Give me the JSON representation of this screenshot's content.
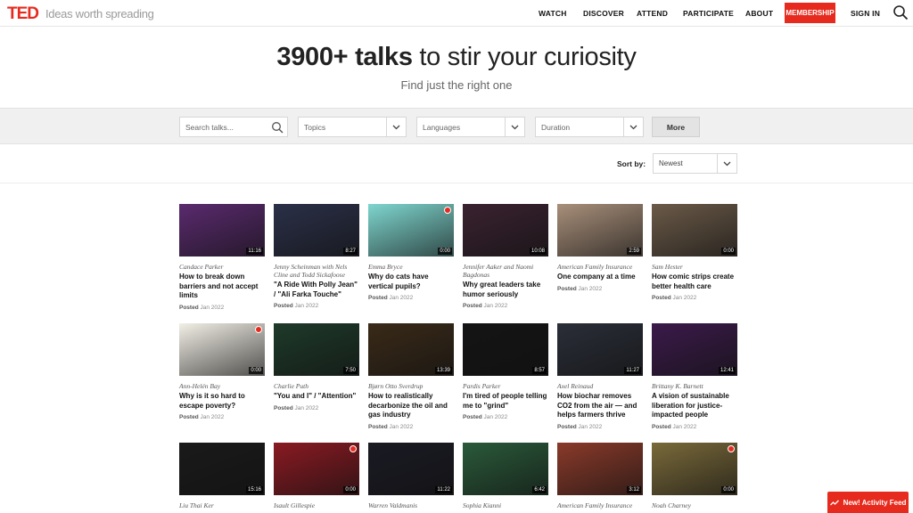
{
  "nav": {
    "logo": "TED",
    "tagline": "Ideas worth spreading",
    "links": [
      "WATCH",
      "DISCOVER",
      "ATTEND",
      "PARTICIPATE",
      "ABOUT"
    ],
    "membership": "MEMBERSHIP",
    "signin": "SIGN IN"
  },
  "hero": {
    "title_bold": "3900+ talks",
    "title_rest": " to stir your curiosity",
    "subtitle": "Find just the right one"
  },
  "filters": {
    "search_placeholder": "Search talks...",
    "topics": "Topics",
    "languages": "Languages",
    "duration": "Duration",
    "more": "More",
    "sort_label": "Sort by:",
    "sort_value": "Newest"
  },
  "talks": [
    {
      "speaker": "Candace Parker",
      "title": "How to break down barriers and not accept limits",
      "posted": "Jan 2022",
      "duration": "11:16",
      "badge": false,
      "bg": "#5a2a6e"
    },
    {
      "speaker": "Jenny Scheinman with Nels Cline and Todd Sickafoose",
      "title": "\"A Ride With Polly Jean\" / \"Ali Farka Touche\"",
      "posted": "Jan 2022",
      "duration": "8:27",
      "badge": false,
      "bg": "#2b3048"
    },
    {
      "speaker": "Emma Bryce",
      "title": "Why do cats have vertical pupils?",
      "posted": "Jan 2022",
      "duration": "0:00",
      "badge": true,
      "bg": "#7fd6cf"
    },
    {
      "speaker": "Jennifer Aaker and Naomi Bagdonas",
      "title": "Why great leaders take humor seriously",
      "posted": "Jan 2022",
      "duration": "10:08",
      "badge": false,
      "bg": "#3a2230"
    },
    {
      "speaker": "American Family Insurance",
      "title": "One company at a time",
      "posted": "Jan 2022",
      "duration": "2:59",
      "badge": false,
      "bg": "#a88f7a"
    },
    {
      "speaker": "Sam Hester",
      "title": "How comic strips create better health care",
      "posted": "Jan 2022",
      "duration": "0:00",
      "badge": false,
      "bg": "#6b5a48"
    },
    {
      "speaker": "Ann-Helén Bay",
      "title": "Why is it so hard to escape poverty?",
      "posted": "Jan 2022",
      "duration": "0:00",
      "badge": true,
      "bg": "#f2efe6"
    },
    {
      "speaker": "Charlie Puth",
      "title": "\"You and I\" / \"Attention\"",
      "posted": "Jan 2022",
      "duration": "7:50",
      "badge": false,
      "bg": "#1e3a2a"
    },
    {
      "speaker": "Bjørn Otto Sverdrup",
      "title": "How to realistically decarbonize the oil and gas industry",
      "posted": "Jan 2022",
      "duration": "13:39",
      "badge": false,
      "bg": "#3a2a18"
    },
    {
      "speaker": "Pardis Parker",
      "title": "I'm tired of people telling me to \"grind\"",
      "posted": "Jan 2022",
      "duration": "8:57",
      "badge": false,
      "bg": "#141414"
    },
    {
      "speaker": "Axel Reinaud",
      "title": "How biochar removes CO2 from the air — and helps farmers thrive",
      "posted": "Jan 2022",
      "duration": "11:27",
      "badge": false,
      "bg": "#2a2e38"
    },
    {
      "speaker": "Brittany K. Barnett",
      "title": "A vision of sustainable liberation for justice-impacted people",
      "posted": "Jan 2022",
      "duration": "12:41",
      "badge": false,
      "bg": "#3b1a4a"
    },
    {
      "speaker": "Liu Thai Ker",
      "title": "",
      "posted": "",
      "duration": "15:16",
      "badge": false,
      "bg": "#1a1a1a"
    },
    {
      "speaker": "Isault Gillespie",
      "title": "",
      "posted": "",
      "duration": "0:00",
      "badge": true,
      "bg": "#8a1a22"
    },
    {
      "speaker": "Warren Valdmanis",
      "title": "",
      "posted": "",
      "duration": "11:22",
      "badge": false,
      "bg": "#1a1a24"
    },
    {
      "speaker": "Sophia Kianni",
      "title": "",
      "posted": "",
      "duration": "6:42",
      "badge": false,
      "bg": "#2a5a3a"
    },
    {
      "speaker": "American Family Insurance",
      "title": "",
      "posted": "",
      "duration": "3:12",
      "badge": false,
      "bg": "#8a3a2a"
    },
    {
      "speaker": "Noah Charney",
      "title": "",
      "posted": "",
      "duration": "0:00",
      "badge": true,
      "bg": "#7a6a3a"
    }
  ],
  "posted_label": "Posted",
  "activity_feed": "New! Activity Feed",
  "colors": {
    "brand_red": "#e62b1e"
  }
}
